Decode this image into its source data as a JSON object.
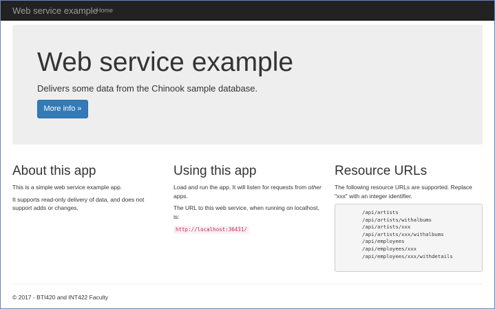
{
  "navbar": {
    "brand": "Web service example",
    "links": [
      {
        "label": "Home"
      }
    ]
  },
  "jumbotron": {
    "title": "Web service example",
    "lead": "Delivers some data from the Chinook sample database.",
    "button_label": "More info »"
  },
  "columns": {
    "about": {
      "heading": "About this app",
      "paragraphs": [
        "This is a simple web service example app.",
        "It supports read-only delivery of data, and does not support adds or changes."
      ]
    },
    "using": {
      "heading": "Using this app",
      "p1_before": "Load and run the app. It will listen for requests from ",
      "p1_em": "other",
      "p1_after": " apps.",
      "p2": "The URL to this web service, when running on localhost, is:",
      "code": "http://localhost:36431/"
    },
    "resources": {
      "heading": "Resource URLs",
      "intro": "The following resource URLs are supported. Replace \"xxx\" with an integer identifier.",
      "urls": [
        "/api/artists",
        "/api/artists/withalbums",
        "/api/artists/xxx",
        "/api/artists/xxx/withalbums",
        "/api/employees",
        "/api/employees/xxx",
        "/api/employees/xxx/withdetails"
      ]
    }
  },
  "footer": {
    "text": "© 2017 - BTI420 and INT422 Faculty"
  },
  "colors": {
    "navbar_bg": "#222222",
    "jumbotron_bg": "#eeeeee",
    "primary": "#337ab7",
    "code_text": "#c7254e"
  }
}
